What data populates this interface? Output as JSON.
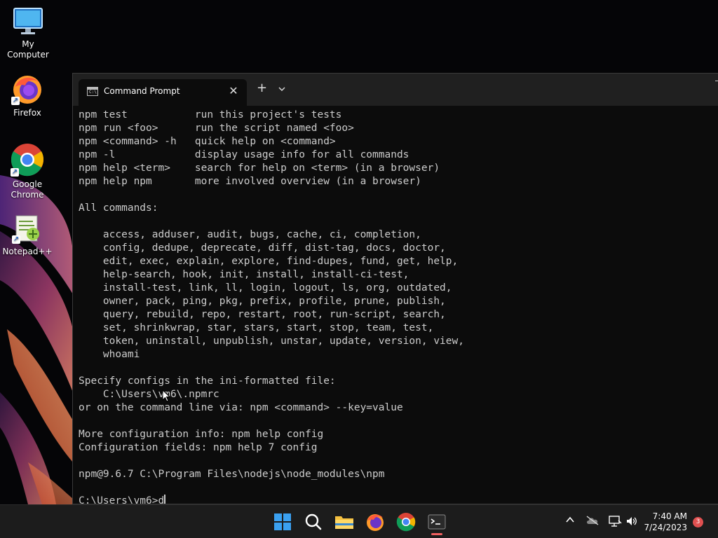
{
  "desktop": {
    "icons": [
      {
        "label": "My Computer"
      },
      {
        "label": "Firefox"
      },
      {
        "label": "Google Chrome"
      },
      {
        "label": "Notepad++"
      }
    ]
  },
  "window": {
    "tab_title": "Command Prompt",
    "close_glyph": "✕",
    "new_tab_glyph": "+",
    "dropdown_glyph": "⌄"
  },
  "console": {
    "lines": [
      "npm test           run this project's tests",
      "npm run <foo>      run the script named <foo>",
      "npm <command> -h   quick help on <command>",
      "npm -l             display usage info for all commands",
      "npm help <term>    search for help on <term> (in a browser)",
      "npm help npm       more involved overview (in a browser)",
      "",
      "All commands:",
      "",
      "    access, adduser, audit, bugs, cache, ci, completion,",
      "    config, dedupe, deprecate, diff, dist-tag, docs, doctor,",
      "    edit, exec, explain, explore, find-dupes, fund, get, help,",
      "    help-search, hook, init, install, install-ci-test,",
      "    install-test, link, ll, login, logout, ls, org, outdated,",
      "    owner, pack, ping, pkg, prefix, profile, prune, publish,",
      "    query, rebuild, repo, restart, root, run-script, search,",
      "    set, shrinkwrap, star, stars, start, stop, team, test,",
      "    token, uninstall, unpublish, unstar, update, version, view,",
      "    whoami",
      "",
      "Specify configs in the ini-formatted file:",
      "    C:\\Users\\vm6\\.npmrc",
      "or on the command line via: npm <command> --key=value",
      "",
      "More configuration info: npm help config",
      "Configuration fields: npm help 7 config",
      "",
      "npm@9.6.7 C:\\Program Files\\nodejs\\node_modules\\npm",
      ""
    ],
    "prompt": "C:\\Users\\vm6>",
    "input": "d"
  },
  "taskbar": {
    "time": "7:40 AM",
    "date": "7/24/2023",
    "notification_count": "3",
    "tray_chevron": "^"
  },
  "colors": {
    "console_bg": "#0c0c0c",
    "console_text": "#cccccc",
    "titlebar": "#202020",
    "taskbar": "#1c1c1c",
    "badge": "#e05050"
  }
}
